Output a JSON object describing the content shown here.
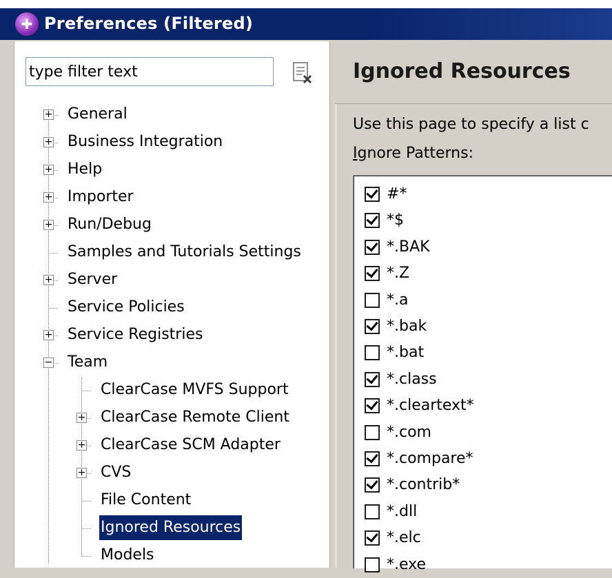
{
  "window": {
    "title": "Preferences (Filtered)"
  },
  "filter": {
    "placeholder": "type filter text"
  },
  "tree": [
    {
      "label": "General",
      "expander": "+",
      "level": 0
    },
    {
      "label": "Business Integration",
      "expander": "+",
      "level": 0
    },
    {
      "label": "Help",
      "expander": "+",
      "level": 0
    },
    {
      "label": "Importer",
      "expander": "+",
      "level": 0
    },
    {
      "label": "Run/Debug",
      "expander": "+",
      "level": 0
    },
    {
      "label": "Samples and Tutorials Settings",
      "expander": "",
      "level": 0
    },
    {
      "label": "Server",
      "expander": "+",
      "level": 0
    },
    {
      "label": "Service Policies",
      "expander": "",
      "level": 0
    },
    {
      "label": "Service Registries",
      "expander": "+",
      "level": 0
    },
    {
      "label": "Team",
      "expander": "−",
      "level": 0
    },
    {
      "label": "ClearCase MVFS Support",
      "expander": "",
      "level": 1
    },
    {
      "label": "ClearCase Remote Client",
      "expander": "+",
      "level": 1
    },
    {
      "label": "ClearCase SCM Adapter",
      "expander": "+",
      "level": 1
    },
    {
      "label": "CVS",
      "expander": "+",
      "level": 1
    },
    {
      "label": "File Content",
      "expander": "",
      "level": 1
    },
    {
      "label": "Ignored Resources",
      "expander": "",
      "level": 1,
      "selected": true
    },
    {
      "label": "Models",
      "expander": "",
      "level": 1
    }
  ],
  "page": {
    "title": "Ignored Resources",
    "description": "Use this page to specify a list c",
    "patterns_label_prefix": "I",
    "patterns_label_rest": "gnore Patterns:"
  },
  "patterns": [
    {
      "text": "#*",
      "checked": true
    },
    {
      "text": "*$",
      "checked": true
    },
    {
      "text": "*.BAK",
      "checked": true
    },
    {
      "text": "*.Z",
      "checked": true
    },
    {
      "text": "*.a",
      "checked": false
    },
    {
      "text": "*.bak",
      "checked": true
    },
    {
      "text": "*.bat",
      "checked": false
    },
    {
      "text": "*.class",
      "checked": true
    },
    {
      "text": "*.cleartext*",
      "checked": true
    },
    {
      "text": "*.com",
      "checked": false
    },
    {
      "text": "*.compare*",
      "checked": true
    },
    {
      "text": "*.contrib*",
      "checked": true
    },
    {
      "text": "*.dll",
      "checked": false
    },
    {
      "text": "*.elc",
      "checked": true
    },
    {
      "text": "*.exe",
      "checked": false
    }
  ]
}
